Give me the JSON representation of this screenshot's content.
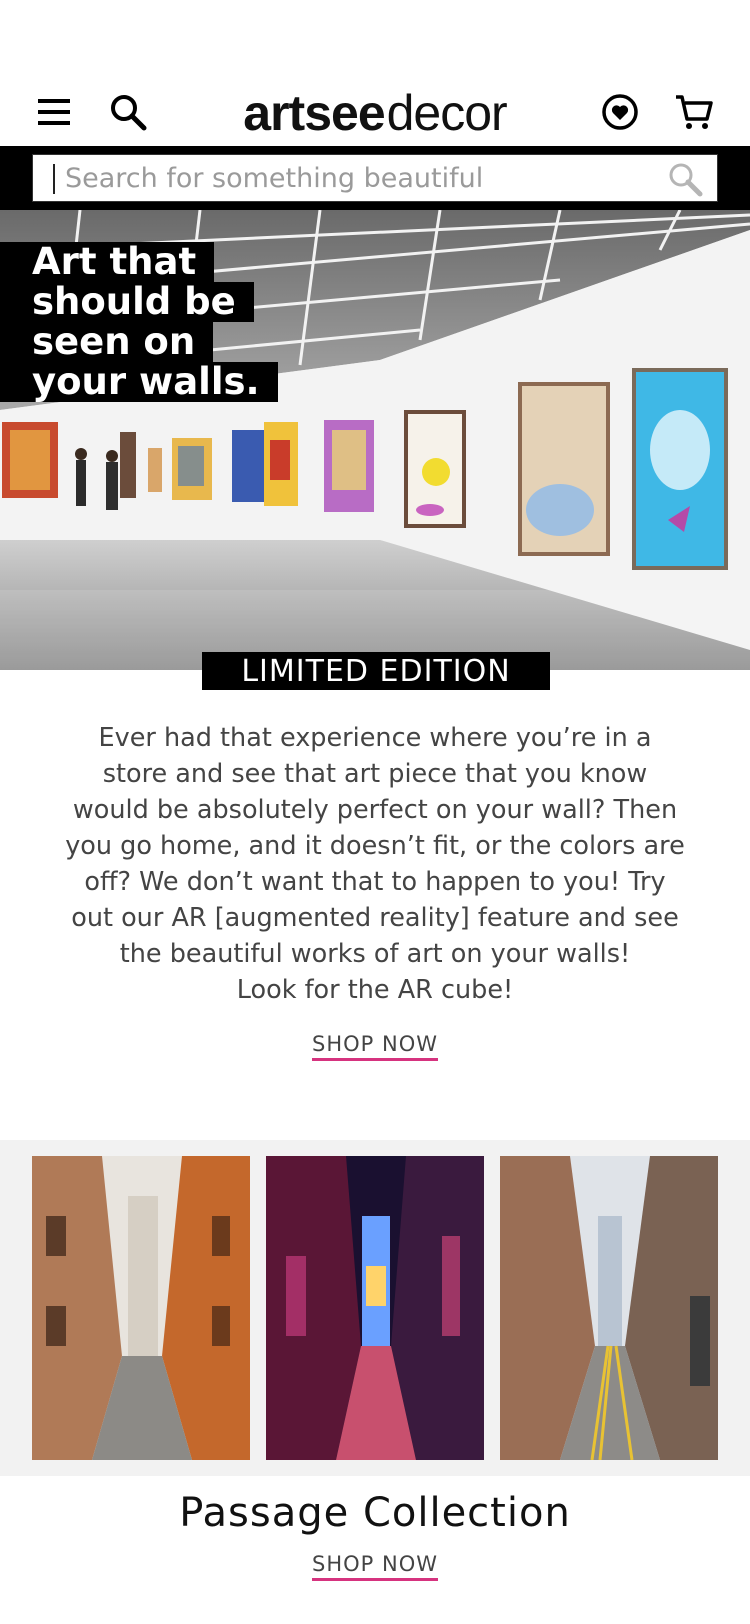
{
  "header": {
    "logo_bold": "artsee",
    "logo_light": "decor",
    "icons": [
      "hamburger-menu-icon",
      "search-icon",
      "heart-circle-icon",
      "cart-icon"
    ]
  },
  "search": {
    "placeholder": "Search for something beautiful"
  },
  "hero": {
    "headline_lines": [
      "Art that",
      "should be",
      "seen on",
      "your walls."
    ],
    "badge": "LIMITED EDITION"
  },
  "intro": {
    "text_lines": [
      "Ever had that experience where you’re in a",
      "store and see that art piece that you know",
      "would be absolutely perfect on your wall? Then",
      "you go home, and it doesn’t fit, or the colors are",
      "off? We don’t want that to happen to you! Try",
      "out our AR [augmented reality] feature and see",
      "the beautiful works of art on your walls!",
      "Look for the AR cube!"
    ],
    "cta": "SHOP NOW"
  },
  "collection": {
    "title": "Passage Collection",
    "cta": "SHOP NOW"
  },
  "colors": {
    "accent_underline": "#d6337f",
    "band_background": "#f2f2f2",
    "black": "#000000"
  }
}
